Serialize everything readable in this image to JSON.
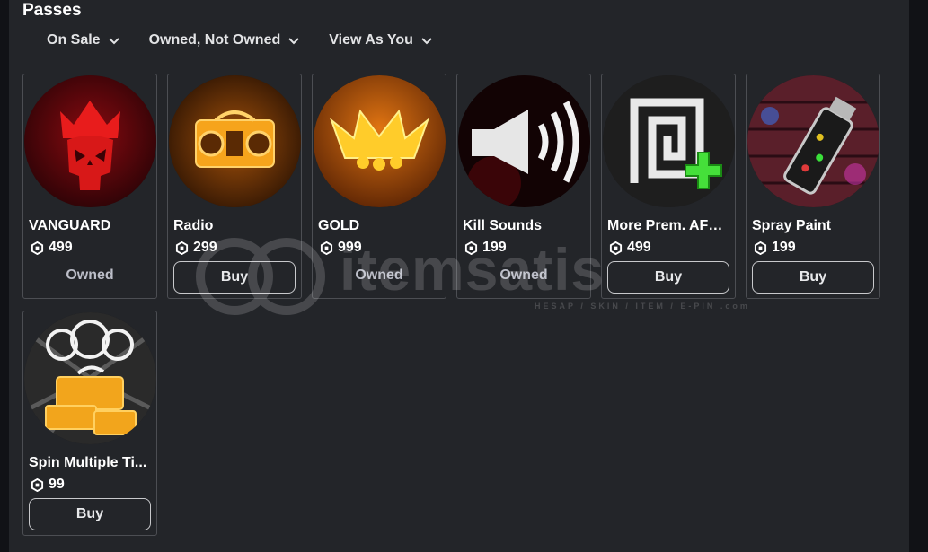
{
  "section": {
    "title": "Passes"
  },
  "filters": [
    {
      "label": "On Sale"
    },
    {
      "label": "Owned, Not Owned"
    },
    {
      "label": "View As You"
    }
  ],
  "items": [
    {
      "name": "VANGUARD",
      "price": "499",
      "status": "Owned",
      "icon": "red-skull-crown-icon"
    },
    {
      "name": "Radio",
      "price": "299",
      "action": "Buy",
      "icon": "boombox-icon"
    },
    {
      "name": "GOLD",
      "price": "999",
      "status": "Owned",
      "icon": "gold-crown-icon"
    },
    {
      "name": "Kill Sounds",
      "price": "199",
      "status": "Owned",
      "icon": "speaker-icon"
    },
    {
      "name": "More Prem. AFK ...",
      "price": "499",
      "action": "Buy",
      "icon": "premium-afk-plus-icon"
    },
    {
      "name": "Spray Paint",
      "price": "199",
      "action": "Buy",
      "icon": "spray-can-icon"
    },
    {
      "name": "Spin Multiple Ti...",
      "price": "99",
      "action": "Buy",
      "icon": "spin-wheels-chest-icon"
    }
  ],
  "watermark": {
    "text": "itemsatis",
    "subtext": "HESAP / SKIN / ITEM / E-PIN .com"
  },
  "colors": {
    "background": "#111216",
    "panel": "#232529",
    "border": "#4c4e53",
    "muted_text": "#bcbec8"
  }
}
